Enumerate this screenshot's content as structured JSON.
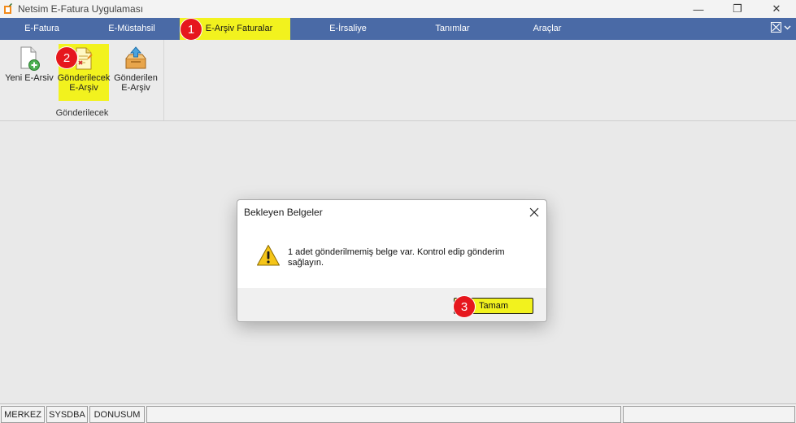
{
  "window": {
    "title": "Netsim E-Fatura Uygulaması",
    "minimize_glyph": "—",
    "restore_glyph": "❐",
    "close_glyph": "✕"
  },
  "menu": {
    "items": [
      {
        "label": "E-Fatura"
      },
      {
        "label": "E-Müstahsil"
      },
      {
        "label": "E-Arşiv Faturalar",
        "active": true
      },
      {
        "label": "E-İrsaliye"
      },
      {
        "label": "Tanımlar"
      },
      {
        "label": "Araçlar"
      }
    ]
  },
  "ribbon": {
    "buttons": [
      {
        "label_line1": "Yeni E-Arsiv",
        "label_line2": "",
        "icon": "new-document-icon"
      },
      {
        "label_line1": "Gönderilecek",
        "label_line2": "E-Arşiv",
        "icon": "pending-document-icon",
        "highlighted": true
      },
      {
        "label_line1": "Gönderilen",
        "label_line2": "E-Arşiv",
        "icon": "sent-archive-icon"
      }
    ],
    "group_label": "Gönderilecek"
  },
  "steps": {
    "one": "1",
    "two": "2",
    "three": "3"
  },
  "dialog": {
    "title": "Bekleyen Belgeler",
    "message": "1 adet gönderilmemiş belge var. Kontrol edip gönderim sağlayın.",
    "ok_label": "Tamam",
    "icon": "warning-icon"
  },
  "statusbar": {
    "cells": [
      "MERKEZ",
      "SYSDBA",
      "DONUSUM"
    ]
  },
  "colors": {
    "menu_bg": "#4a6aa6",
    "highlight": "#f2f21e",
    "badge": "#e6171d"
  }
}
